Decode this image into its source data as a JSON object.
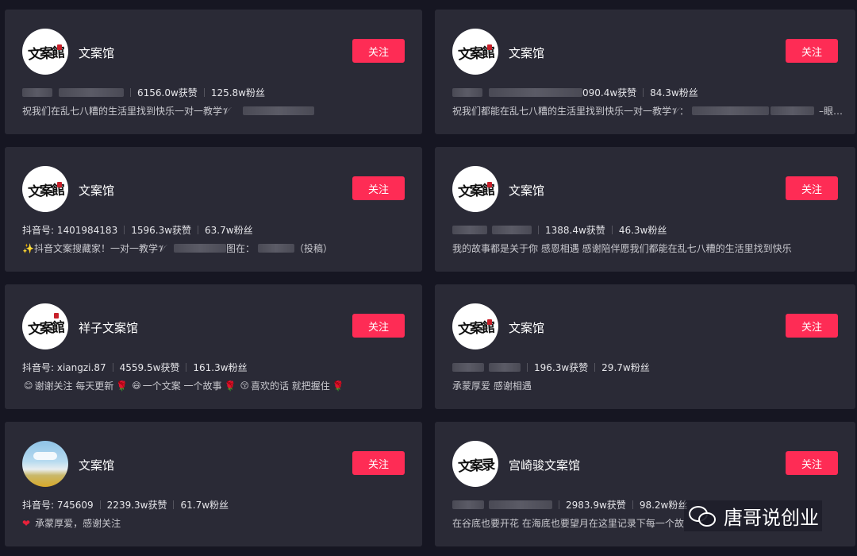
{
  "ui": {
    "follow_label": "关注"
  },
  "cards": [
    {
      "name": "文案馆",
      "avatar": "文案館",
      "stats": {
        "id": "",
        "likes": "6156.0w获赞",
        "fans": "125.8w粉丝"
      },
      "bio": {
        "text": "祝我们在乱七八糟的生活里找到快乐一对一教学𝒱",
        "tail": ""
      }
    },
    {
      "name": "文案馆",
      "avatar": "文案館",
      "stats": {
        "id": "",
        "likes": "090.4w获赞",
        "fans": "84.3w粉丝"
      },
      "bio": {
        "text": "祝我们都能在乱七八糟的生活里找到快乐一对一教学𝒱：",
        "tail": "–眼…"
      }
    },
    {
      "name": "文案馆",
      "avatar": "文案館",
      "stats": {
        "id": "抖音号: 1401984183",
        "likes": "1596.3w获赞",
        "fans": "63.7w粉丝"
      },
      "bio": {
        "text": "✨抖音文案搜藏家！一对一教学𝒱",
        "mid": "图在：",
        "tail": "（投稿）"
      }
    },
    {
      "name": "文案馆",
      "avatar": "文案館",
      "stats": {
        "id": "",
        "likes": "1388.4w获赞",
        "fans": "46.3w粉丝"
      },
      "bio": {
        "text": "我的故事都是关于你 感恩相遇 感谢陪伴愿我们都能在乱七八糟的生活里找到快乐"
      }
    },
    {
      "name": "祥子文案馆",
      "avatar": "文案館",
      "stats": {
        "id": "抖音号: xiangzi.87",
        "likes": "4559.5w获赞",
        "fans": "161.3w粉丝"
      },
      "bio": {
        "p1": "谢谢关注 每天更新",
        "p2": "一个文案 一个故事",
        "p3": "喜欢的话 就把握住"
      }
    },
    {
      "name": "文案馆",
      "avatar": "文案館",
      "stats": {
        "id": "",
        "likes": "196.3w获赞",
        "fans": "29.7w粉丝"
      },
      "bio": {
        "text": "承蒙厚爱 感谢相遇"
      }
    },
    {
      "name": "文案馆",
      "avatar": "",
      "stats": {
        "id": "抖音号: 745609",
        "likes": "2239.3w获赞",
        "fans": "61.7w粉丝"
      },
      "bio": {
        "text": "承蒙厚爱，感谢关注"
      }
    },
    {
      "name": "宫崎骏文案馆",
      "avatar": "文案录",
      "stats": {
        "id": "",
        "likes": "2983.9w获赞",
        "fans": "98.2w粉丝"
      },
      "bio": {
        "text": "在谷底也要开花 在海底也要望月在这里记录下每一个故"
      }
    }
  ],
  "watermark": {
    "text": "唐哥说创业",
    "icon": "wechat-icon"
  },
  "colors": {
    "background": "#161622",
    "card": "#2a2a36",
    "accent": "#fe2c55"
  }
}
